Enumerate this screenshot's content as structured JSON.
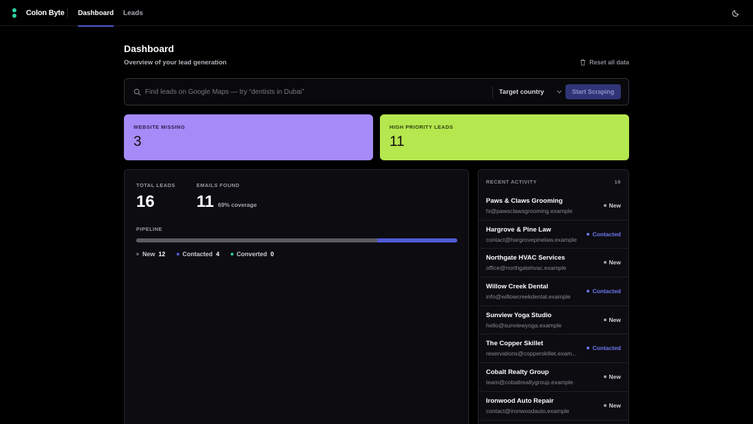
{
  "app": {
    "name": "Colon Byte"
  },
  "nav": {
    "tabs": [
      {
        "label": "Dashboard"
      },
      {
        "label": "Leads"
      }
    ]
  },
  "header": {
    "title": "Dashboard",
    "subtitle": "Overview of your lead generation",
    "reset_label": "Reset all data"
  },
  "search": {
    "placeholder": "Find leads on Google Maps — try “dentists in Dubai”",
    "value": "",
    "country_label": "Target country",
    "button_label": "Start Scraping"
  },
  "cards": [
    {
      "label": "WEBSITE MISSING",
      "value": "3",
      "color": "#a68af7"
    },
    {
      "label": "HIGH PRIORITY LEADS",
      "value": "11",
      "color": "#b5e74e"
    }
  ],
  "overview": {
    "total_label": "TOTAL LEADS",
    "total_value": "16",
    "emails_label": "EMAILS FOUND",
    "emails_value": "11",
    "coverage": "69% coverage",
    "pipeline_label": "PIPELINE",
    "pipeline": [
      {
        "label": "New",
        "count": 12,
        "color": "#5b5b63"
      },
      {
        "label": "Contacted",
        "count": 4,
        "color": "#4f5bd5"
      },
      {
        "label": "Converted",
        "count": 0,
        "color": "#2dd4a3"
      }
    ]
  },
  "activity": {
    "title": "RECENT ACTIVITY",
    "count": "16",
    "items": [
      {
        "name": "Paws & Claws Grooming",
        "email": "hi@pawsclawsgrooming.example",
        "status": "New"
      },
      {
        "name": "Hargrove & Pine Law",
        "email": "contact@hargrovepinelaw.example",
        "status": "Contacted"
      },
      {
        "name": "Northgate HVAC Services",
        "email": "office@northgatehvac.example",
        "status": "New"
      },
      {
        "name": "Willow Creek Dental",
        "email": "info@willowcreekdental.example",
        "status": "Contacted"
      },
      {
        "name": "Sunview Yoga Studio",
        "email": "hello@sunviewyoga.example",
        "status": "New"
      },
      {
        "name": "The Copper Skillet",
        "email": "reservations@copperskillet.exam...",
        "status": "Contacted"
      },
      {
        "name": "Cobalt Realty Group",
        "email": "team@cobaltrealtygroup.example",
        "status": "New"
      },
      {
        "name": "Ironwood Auto Repair",
        "email": "contact@ironwoodauto.example",
        "status": "New"
      }
    ]
  }
}
